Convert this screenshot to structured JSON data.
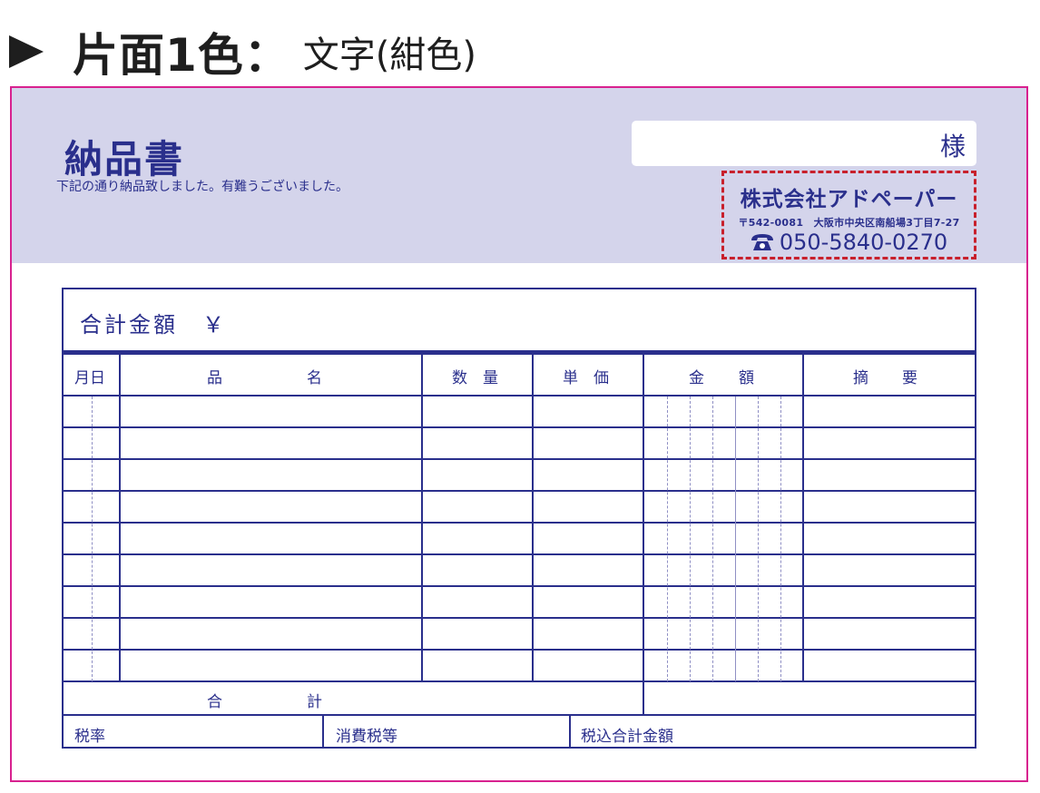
{
  "header": {
    "main": "片面1色：",
    "sub": "文字(紺色)"
  },
  "document": {
    "title": "納品書",
    "recipient_suffix": "様",
    "note": "下記の通り納品致しました。有難うございました。",
    "total_label": "合計金額　￥"
  },
  "company": {
    "name": "株式会社アドペーパー",
    "address": "〒542-0081　大阪市中央区南船場3丁目7-27",
    "phone": "050-5840-0270",
    "phone_icon": "telephone-icon"
  },
  "table": {
    "headers": {
      "date": "月日",
      "item_1": "品",
      "item_2": "名",
      "qty": "数　量",
      "unit_price": "単　価",
      "amount_1": "金",
      "amount_2": "額",
      "remarks_1": "摘",
      "remarks_2": "要"
    },
    "row_count": 9,
    "footer": {
      "total_1": "合",
      "total_2": "計",
      "tax_rate": "税率",
      "consumption_tax": "消費税等",
      "tax_incl_total": "税込合計金額"
    }
  },
  "colors": {
    "accent": "#2a2f8c",
    "band": "#d4d4eb",
    "frame": "#d8218f",
    "stamp_border": "#c8202c"
  }
}
